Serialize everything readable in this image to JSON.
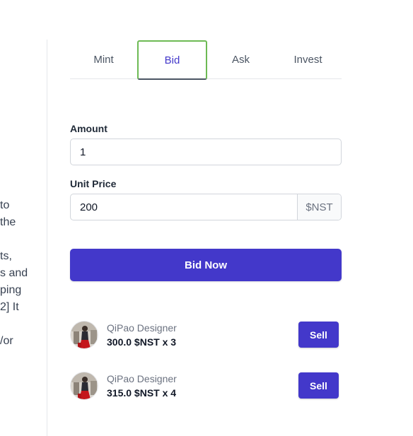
{
  "background_text": {
    "lines": [
      "to",
      "the",
      "",
      "ts,",
      "s and",
      "ping",
      "2] It",
      "",
      "/or"
    ]
  },
  "tabs": [
    {
      "label": "Mint",
      "active": false
    },
    {
      "label": "Bid",
      "active": true
    },
    {
      "label": "Ask",
      "active": false
    },
    {
      "label": "Invest",
      "active": false
    }
  ],
  "form": {
    "amount_label": "Amount",
    "amount_value": "1",
    "unit_price_label": "Unit Price",
    "unit_price_value": "200",
    "currency": "$NST",
    "submit_label": "Bid Now"
  },
  "orders": [
    {
      "seller": "QiPao Designer",
      "price": "300.0 $NST x 3",
      "action": "Sell"
    },
    {
      "seller": "QiPao Designer",
      "price": "315.0 $NST x 4",
      "action": "Sell"
    }
  ],
  "colors": {
    "accent": "#4338ca",
    "active_tab_border": "#6dba54"
  }
}
